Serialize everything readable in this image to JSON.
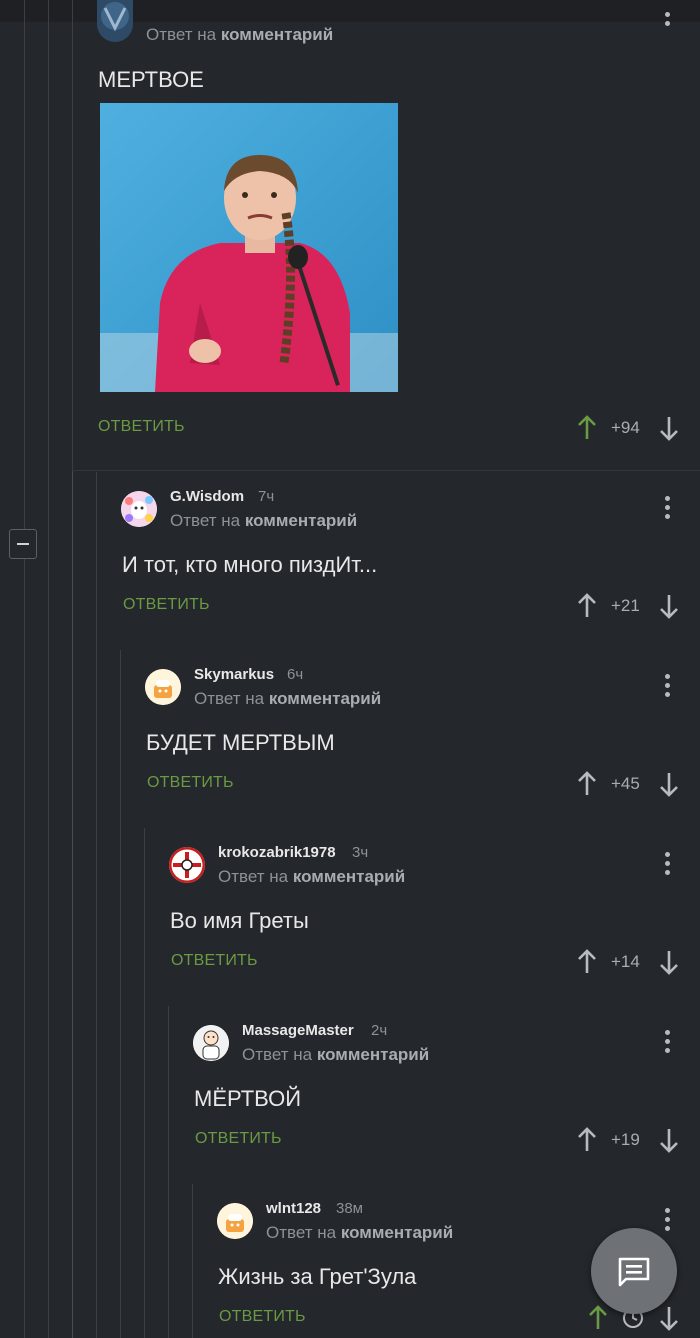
{
  "colors": {
    "background": "#24272b",
    "accent_green": "#6a9a43",
    "muted": "#8e9297",
    "upvote_active": "#6a9a43"
  },
  "top_comment": {
    "reply_prefix": "Ответ на",
    "reply_target": "комментарий",
    "text": "МЕРТВОЕ",
    "answer_label": "ОТВЕТИТЬ",
    "score": "+94"
  },
  "comments": [
    {
      "username": "G.Wisdom",
      "time": "7ч",
      "reply_prefix": "Ответ на",
      "reply_target": "комментарий",
      "text": "И тот, кто много пиздИт...",
      "answer_label": "ОТВЕТИТЬ",
      "score": "+21"
    },
    {
      "username": "Skymarkus",
      "time": "6ч",
      "reply_prefix": "Ответ на",
      "reply_target": "комментарий",
      "text": "БУДЕТ МЕРТВЫМ",
      "answer_label": "ОТВЕТИТЬ",
      "score": "+45"
    },
    {
      "username": "krokozabrik1978",
      "time": "3ч",
      "reply_prefix": "Ответ на",
      "reply_target": "комментарий",
      "text": "Во имя Греты",
      "answer_label": "ОТВЕТИТЬ",
      "score": "+14"
    },
    {
      "username": "MassageMaster",
      "time": "2ч",
      "reply_prefix": "Ответ на",
      "reply_target": "комментарий",
      "text": "МЁРТВОЙ",
      "answer_label": "ОТВЕТИТЬ",
      "score": "+19"
    },
    {
      "username": "wlnt128",
      "time": "38м",
      "reply_prefix": "Ответ на",
      "reply_target": "комментарий",
      "text": "Жизнь за Грет'Зула",
      "answer_label": "ОТВЕТИТЬ",
      "score": ""
    }
  ],
  "icons": {
    "upvote": "arrow-up-icon",
    "downvote": "arrow-down-icon",
    "menu": "more-vertical-icon",
    "collapse": "minus-icon",
    "fab": "comments-icon",
    "clock": "clock-icon"
  }
}
